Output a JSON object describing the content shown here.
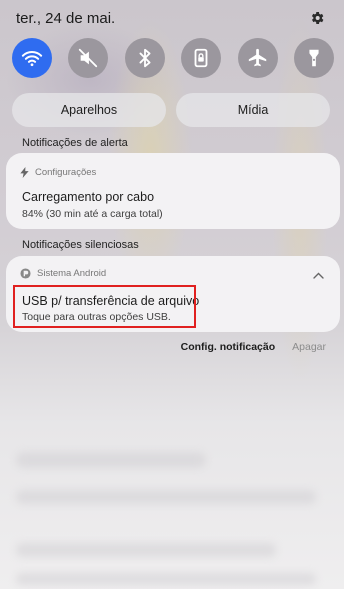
{
  "status_bar": {
    "date": "ter., 24 de mai."
  },
  "quick_settings": {
    "toggles": [
      {
        "name": "wifi-icon",
        "state": "on"
      },
      {
        "name": "sound-off-icon",
        "state": "off"
      },
      {
        "name": "bluetooth-icon",
        "state": "off"
      },
      {
        "name": "orientation-lock-icon",
        "state": "off"
      },
      {
        "name": "airplane-icon",
        "state": "off"
      },
      {
        "name": "flashlight-icon",
        "state": "off"
      }
    ],
    "accent_color": "#2f6cf0",
    "buttons": {
      "devices": "Aparelhos",
      "media": "Mídia"
    }
  },
  "alert_section": {
    "label": "Notificações de alerta",
    "notification": {
      "app_name": "Configurações",
      "title": "Carregamento por cabo",
      "body": "84% (30 min até a carga total)"
    }
  },
  "silent_section": {
    "label": "Notificações silenciosas",
    "notification": {
      "app_name": "Sistema Android",
      "title": "USB p/ transferência de arquivo",
      "body": "Toque para outras opções USB.",
      "highlight_color": "#e02020"
    }
  },
  "actions": {
    "settings": "Config. notificação",
    "clear": "Apagar"
  }
}
